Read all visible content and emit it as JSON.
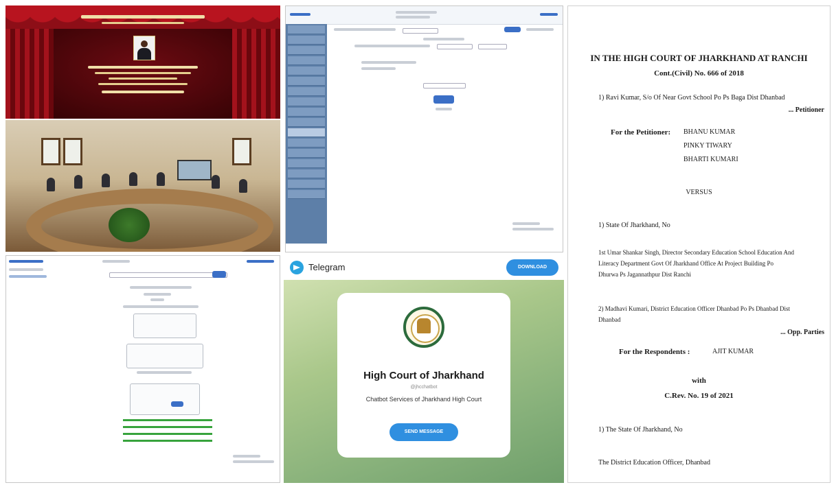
{
  "stage": {
    "colors": {
      "curtain": "#a3121c",
      "text": "#f7e9c4"
    }
  },
  "telegram": {
    "app_title": "Telegram",
    "download_label": "DOWNLOAD",
    "channel_name": "High Court of Jharkhand",
    "handle": "@jhcchatbot",
    "description": "Chatbot Services of Jharkhand High Court",
    "send_label": "SEND MESSAGE",
    "colors": {
      "accent": "#2f8fe0",
      "logo": "#2aa3df"
    }
  },
  "document": {
    "court_title": "IN THE HIGH COURT OF JHARKHAND AT RANCHI",
    "case_no": "Cont.(Civil) No. 666 of 2018",
    "petitioner_line": "1) Ravi Kumar, S/o Of Near Govt School Po Ps Baga Dist Dhanbad",
    "petitioner_role": "... Petitioner",
    "for_petitioner_label": "For the Petitioner:",
    "petitioner_counsel": [
      "BHANU KUMAR",
      "PINKY TIWARY",
      "BHARTI KUMARI"
    ],
    "versus": "VERSUS",
    "respondent_1": "1) State Of Jharkhand, No",
    "respondent_1a_line1": "1st Umar Shankar Singh, Director Secondary Education School Education And",
    "respondent_1a_line2": "Literacy Department Govt Of Jharkhand Office At Project Building Po",
    "respondent_1a_line3": "Dhurwa Ps Jagannathpur Dist Ranchi",
    "respondent_2_line1": "2) Madhavi Kumari, District Education Officer Dhanbad Po Ps Dhanbad Dist",
    "respondent_2_line2": "Dhanbad",
    "respondent_role": "... Opp. Parties",
    "for_respondent_label": "For the Respondents :",
    "respondent_counsel": "AJIT KUMAR",
    "with": "with",
    "linked_case": "C.Rev. No. 19 of 2021",
    "linked_respondent_1": "1) The State Of Jharkhand, No",
    "linked_respondent_2": "The District Education Officer, Dhanbad"
  }
}
